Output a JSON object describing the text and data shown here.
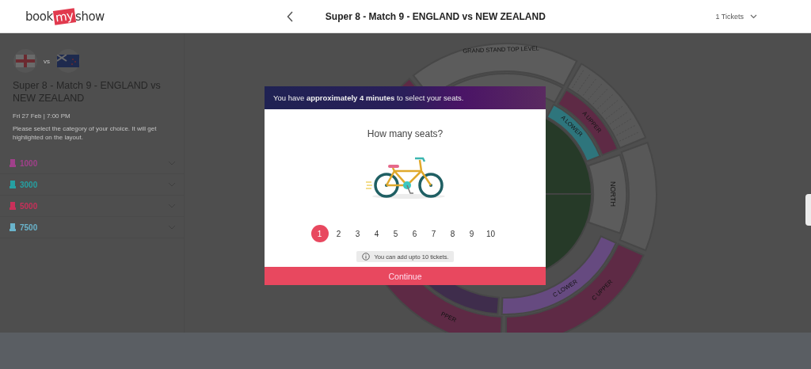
{
  "header": {
    "logo": [
      "book",
      "my",
      "show"
    ],
    "title": "Super 8 - Match 9 - ENGLAND vs NEW ZEALAND",
    "tickets": "1 Tickets"
  },
  "event": {
    "vs": "vs",
    "title": "Super 8 - Match 9 - ENGLAND vs NEW ZEALAND",
    "datetime": "Fri 27 Feb | 7:00 PM",
    "instruction": "Please select the category of your choice. It will get highlighted on the layout."
  },
  "categories": [
    {
      "price": "1000",
      "color": "#a0408a"
    },
    {
      "price": "3000",
      "color": "#26a0a2"
    },
    {
      "price": "5000",
      "color": "#c8305a"
    },
    {
      "price": "7500",
      "color": "#6ab4cc"
    }
  ],
  "stadium": {
    "sections": [
      {
        "label": "GRAND STAND TOP LEVEL",
        "color": "#5c5c5c"
      },
      {
        "label": "A UPPER",
        "color": "#5e2a45"
      },
      {
        "label": "A LOWER",
        "color": "#2e757c"
      },
      {
        "label": "NORTH",
        "color": "#5c5c5c"
      },
      {
        "label": "C LOWER",
        "color": "#664a80"
      },
      {
        "label": "C UPPER",
        "color": "#5e2a45"
      },
      {
        "label": "PPER",
        "color": "#5e2a45"
      }
    ]
  },
  "dialog": {
    "notice": "You have **approximately 4 minutes** to select your seats.",
    "heading": "How many seats?",
    "seat_counts": [
      {
        "label": "1",
        "selected": true
      },
      {
        "label": "2",
        "selected": false
      },
      {
        "label": "3",
        "selected": false
      },
      {
        "label": "4",
        "selected": false
      },
      {
        "label": "5",
        "selected": false
      },
      {
        "label": "6",
        "selected": false
      },
      {
        "label": "7",
        "selected": false
      },
      {
        "label": "8",
        "selected": false
      },
      {
        "label": "9",
        "selected": false
      },
      {
        "label": "10",
        "selected": false
      }
    ],
    "info": "You can add upto 10 tickets.",
    "button": "Continue"
  }
}
